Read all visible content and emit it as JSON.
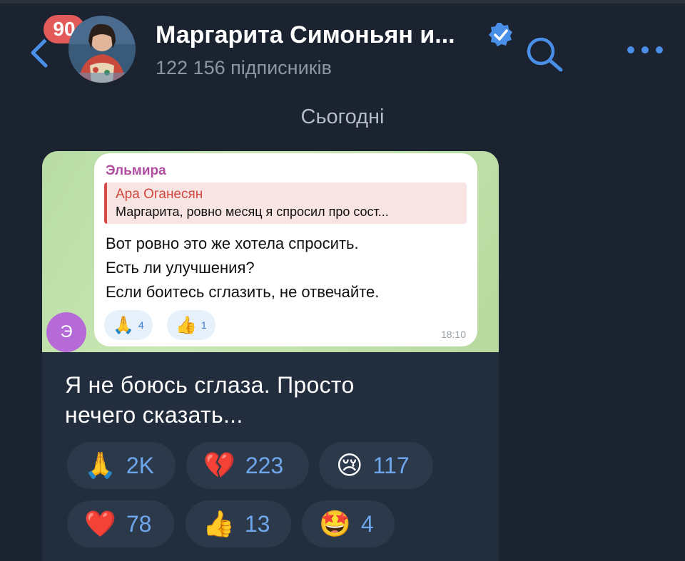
{
  "header": {
    "unread_badge": "90",
    "title": "Маргарита Симоньян и...",
    "subtitle": "122 156 підписників"
  },
  "date_separator": "Сьогодні",
  "forwarded": {
    "avatar_letter": "Э",
    "sender": "Эльмира",
    "reply": {
      "name": "Ара Оганесян",
      "text": "Маргарита, ровно месяц я спросил про сост..."
    },
    "lines": [
      "Вот ровно это же хотела спросить.",
      "Есть ли улучшения?",
      "Если боитесь сглазить, не отвечайте."
    ],
    "reactions": [
      {
        "emoji": "🙏",
        "count": "4"
      },
      {
        "emoji": "👍",
        "count": "1"
      }
    ],
    "time": "18:10"
  },
  "message": {
    "lines": [
      "Я не боюсь сглаза. Просто",
      "нечего сказать..."
    ],
    "reactions": [
      {
        "emoji": "🙏",
        "count": "2K"
      },
      {
        "emoji": "💔",
        "count": "223"
      },
      {
        "emoji": "😢",
        "count": "117"
      },
      {
        "emoji": "❤️",
        "count": "78"
      },
      {
        "emoji": "👍",
        "count": "13"
      },
      {
        "emoji": "🤩",
        "count": "4"
      }
    ]
  },
  "colors": {
    "background": "#1b2330",
    "accent": "#4a8fe7",
    "badge": "#e35a5a",
    "reaction_count": "#6ea7ec"
  },
  "icons": [
    "back-icon",
    "verified-icon",
    "search-icon",
    "more-icon"
  ]
}
